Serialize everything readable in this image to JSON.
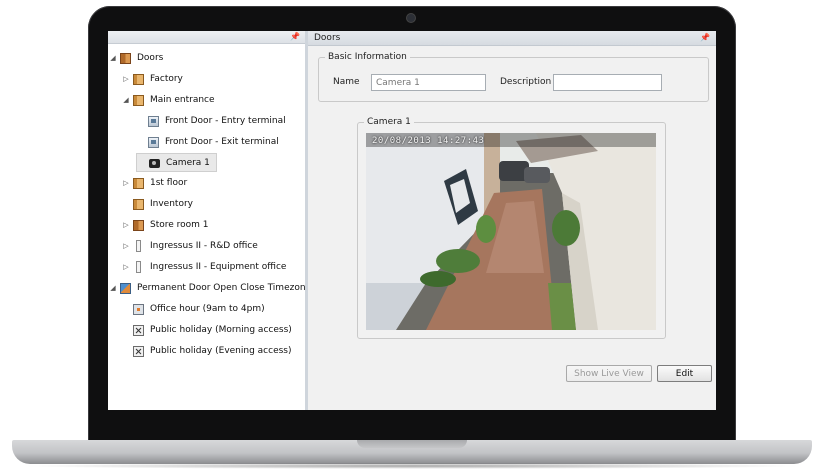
{
  "left_panel": {
    "pin_icon": "pin-icon",
    "tree": [
      {
        "label": "Doors",
        "icon": "doors-folder-icon",
        "expander": "◢"
      },
      {
        "label": "Factory",
        "icon": "folder-icon",
        "expander": "▷"
      },
      {
        "label": "Main entrance",
        "icon": "folder-icon",
        "expander": "◢"
      },
      {
        "label": "Front Door - Entry terminal",
        "icon": "terminal-icon",
        "expander": ""
      },
      {
        "label": "Front Door - Exit terminal",
        "icon": "terminal-icon",
        "expander": ""
      },
      {
        "label": "Camera 1",
        "icon": "camera-icon",
        "expander": "",
        "selected": true
      },
      {
        "label": "1st floor",
        "icon": "folder-icon",
        "expander": "▷"
      },
      {
        "label": "Inventory",
        "icon": "folder-icon",
        "expander": ""
      },
      {
        "label": "Store room 1",
        "icon": "door-icon",
        "expander": "▷"
      },
      {
        "label": "Ingressus II - R&D office",
        "icon": "reader-icon",
        "expander": "▷"
      },
      {
        "label": "Ingressus II - Equipment office",
        "icon": "reader-icon",
        "expander": "▷"
      },
      {
        "label": "Permanent Door Open Close Timezone",
        "icon": "timezone-icon",
        "expander": "◢"
      },
      {
        "label": "Office hour (9am to 4pm)",
        "icon": "clock-icon",
        "expander": ""
      },
      {
        "label": "Public holiday (Morning access)",
        "icon": "holiday-icon",
        "expander": ""
      },
      {
        "label": "Public holiday (Evening access)",
        "icon": "holiday-icon",
        "expander": ""
      }
    ]
  },
  "right_panel": {
    "title": "Doors",
    "basic_info": {
      "legend": "Basic Information",
      "name_label": "Name",
      "name_value": "Camera 1",
      "description_label": "Description",
      "description_value": ""
    },
    "camera": {
      "legend": "Camera 1",
      "osd": "20/08/2013  14:27:43"
    },
    "buttons": {
      "live_view": "Show Live View",
      "edit": "Edit"
    }
  },
  "colors": {
    "selection": "#e9e9e9",
    "panel_bg": "#f1f1f1",
    "header": "#dde1e6"
  }
}
